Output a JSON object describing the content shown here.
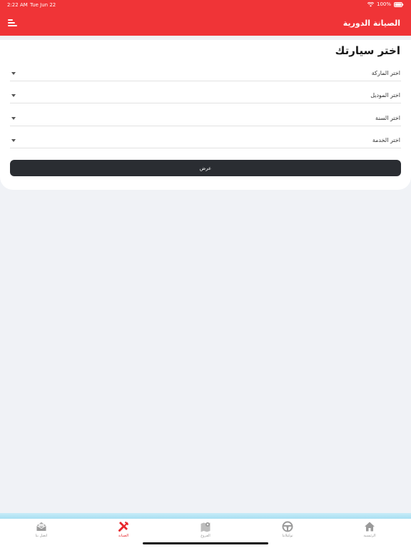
{
  "status": {
    "time": "2:22 AM",
    "date": "Tue Jun 22",
    "battery": "100%"
  },
  "header": {
    "title": "الصيانة الدورية"
  },
  "form": {
    "title": "اختر سيارتك",
    "fields": [
      {
        "label": "اختر الماركة"
      },
      {
        "label": "اختر الموديل"
      },
      {
        "label": "اختر السنة"
      },
      {
        "label": "اختر الخدمة"
      }
    ],
    "submit_label": "عرض"
  },
  "tabs": [
    {
      "label": "اتصل بنا",
      "icon": "mail-open-icon"
    },
    {
      "label": "الصيانة",
      "icon": "tools-icon",
      "active": true
    },
    {
      "label": "الفروع",
      "icon": "map-pin-icon"
    },
    {
      "label": "توكيلاتنا",
      "icon": "steering-wheel-icon"
    },
    {
      "label": "الرئيسية",
      "icon": "home-icon"
    }
  ],
  "colors": {
    "brand_red": "#f03437",
    "button_dark": "#2a2d32",
    "active_tab": "#e8262b",
    "background": "#f0f2f6"
  }
}
